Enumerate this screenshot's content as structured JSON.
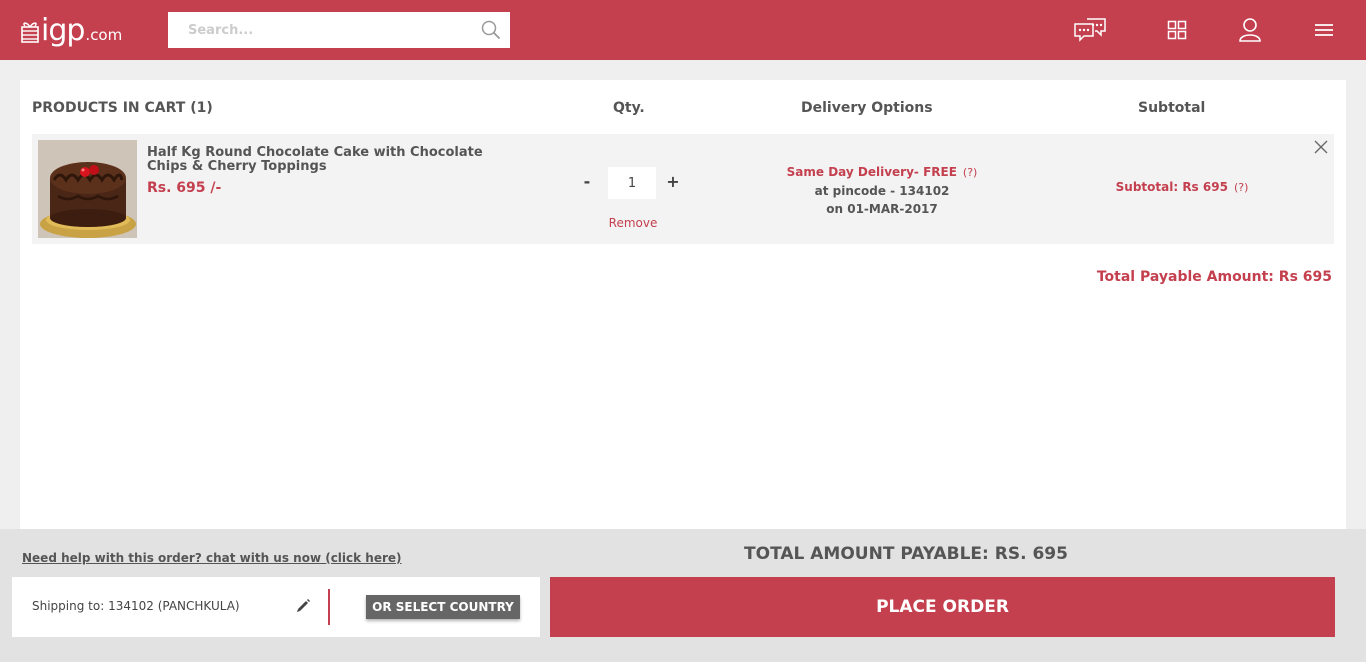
{
  "header": {
    "logo_text": "igp",
    "logo_suffix": ".com",
    "search_placeholder": "Search...",
    "icons": [
      "chat-icon",
      "grid-icon",
      "user-icon",
      "menu-icon"
    ]
  },
  "cart": {
    "columns": {
      "products": "PRODUCTS IN CART (1)",
      "qty": "Qty.",
      "delivery": "Delivery Options",
      "subtotal": "Subtotal"
    },
    "items": [
      {
        "name": "Half Kg Round Chocolate Cake with Chocolate Chips & Cherry Toppings",
        "price": "Rs. 695 /-",
        "qty_minus": "-",
        "qty": "1",
        "qty_plus": "+",
        "remove": "Remove",
        "delivery_type": "Same Day Delivery- FREE",
        "delivery_help": "(?)",
        "delivery_pincode": "at pincode - 134102",
        "delivery_date": "on 01-MAR-2017",
        "subtotal": "Subtotal: Rs 695",
        "subtotal_help": "(?)"
      }
    ],
    "total_payable": "Total Payable Amount: Rs 695"
  },
  "footer": {
    "help_link": "Need help with this order? chat with us now (click here)",
    "grand_total": "TOTAL AMOUNT PAYABLE: RS. 695",
    "shipping": "Shipping to: 134102 (PANCHKULA)",
    "select_country": "OR SELECT COUNTRY",
    "place_order": "PLACE ORDER"
  },
  "colors": {
    "brand": "#c4404f",
    "background": "#efefef",
    "footer": "#e2e2e2",
    "button_dark": "#666666"
  }
}
